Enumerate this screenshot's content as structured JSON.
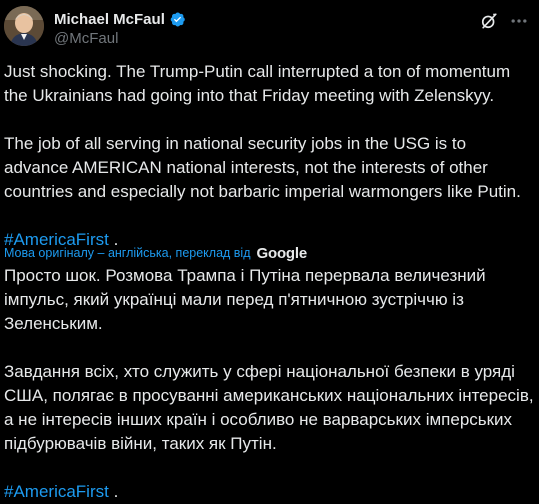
{
  "author": {
    "display_name": "Michael McFaul",
    "handle": "@McFaul",
    "verified_color": "#1d9bf0"
  },
  "icons": {
    "grok": "grok-icon",
    "more": "more-icon",
    "verified": "verified-badge-icon"
  },
  "tweet": {
    "paragraph_1": "Just shocking. The Trump-Putin call interrupted a ton of momentum the Ukrainians had going into that Friday meeting with Zelenskyy.",
    "paragraph_2": "The job of all serving in national security jobs in the USG is to advance AMERICAN national interests, not the interests of other countries and especially not barbaric imperial warmongers like Putin.",
    "hashtag": "#AmericaFirst",
    "hashtag_suffix": " ."
  },
  "translation": {
    "attribution": "Мова оригіналу – англійська, переклад від",
    "provider": "Google",
    "paragraph_1": "Просто шок. Розмова Трампа і Путіна перервала величезний імпульс, який українці мали перед п'ятничною зустріччю із Зеленським.",
    "paragraph_2": "Завдання всіх, хто служить у сфері національної безпеки в уряді США, полягає в просуванні американських національних інтересів, а не інтересів інших країн і особливо не варварських імперських підбурювачів війни, таких як Путін.",
    "hashtag": "#AmericaFirst",
    "hashtag_suffix": " ."
  },
  "colors": {
    "background": "#000000",
    "text": "#e7e9ea",
    "secondary": "#71767b",
    "accent": "#1d9bf0"
  }
}
